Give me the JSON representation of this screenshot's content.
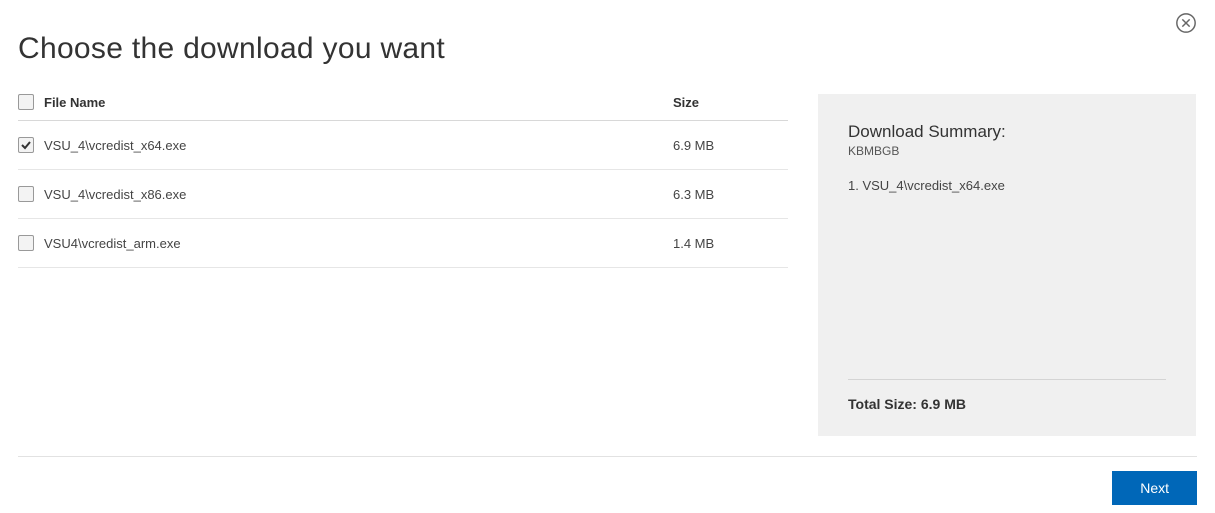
{
  "title": "Choose the download you want",
  "table": {
    "headers": {
      "filename": "File Name",
      "size": "Size"
    },
    "rows": [
      {
        "checked": true,
        "name": "VSU_4\\vcredist_x64.exe",
        "size": "6.9 MB"
      },
      {
        "checked": false,
        "name": "VSU_4\\vcredist_x86.exe",
        "size": "6.3 MB"
      },
      {
        "checked": false,
        "name": "VSU4\\vcredist_arm.exe",
        "size": "1.4 MB"
      }
    ]
  },
  "summary": {
    "title": "Download Summary:",
    "units": "KBMBGB",
    "items": [
      "1.  VSU_4\\vcredist_x64.exe"
    ],
    "total_label": "Total Size: 6.9 MB"
  },
  "buttons": {
    "next": "Next"
  }
}
